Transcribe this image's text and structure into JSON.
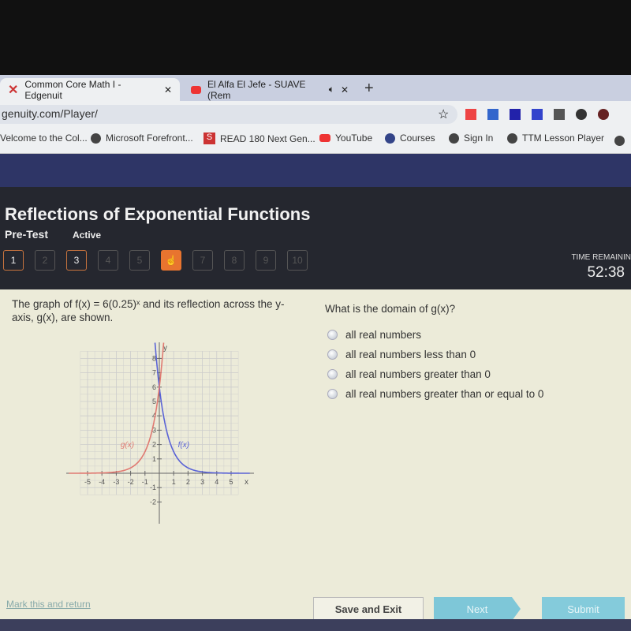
{
  "browser": {
    "tabs": [
      {
        "title": "Common Core Math I - Edgenuit",
        "icon": "edgenuity-x-icon"
      },
      {
        "title": "El Alfa El Jefe - SUAVE (Rem",
        "icon": "youtube-icon",
        "audio": true
      }
    ],
    "url": "genuity.com/Player/",
    "bookmarks": [
      {
        "label": "Velcome to the Col..."
      },
      {
        "label": "Microsoft Forefront..."
      },
      {
        "label": "READ 180 Next Gen..."
      },
      {
        "label": "YouTube"
      },
      {
        "label": "Courses"
      },
      {
        "label": "Sign In"
      },
      {
        "label": "TTM Lesson Player"
      }
    ]
  },
  "header": {
    "title": "Reflections of Exponential Functions",
    "subtitle": "Pre-Test",
    "status": "Active",
    "questions": [
      "1",
      "2",
      "3",
      "4",
      "5",
      "6",
      "7",
      "8",
      "9",
      "10"
    ],
    "completed": [
      1,
      3
    ],
    "current": 6,
    "time_label": "TIME REMAININ",
    "time": "52:38"
  },
  "question": {
    "text": "The graph of f(x) = 6(0.25)ˣ and its reflection across the y-axis, g(x), are shown.",
    "prompt": "What is the domain of g(x)?",
    "options": [
      "all real numbers",
      "all real numbers less than 0",
      "all real numbers greater than 0",
      "all real numbers greater than or equal to 0"
    ]
  },
  "graph": {
    "xlim": [
      -5,
      5
    ],
    "ylim": [
      -2,
      8
    ],
    "xlabel": "x",
    "ylabel": "y",
    "xticks": [
      -5,
      -4,
      -3,
      -2,
      -1,
      1,
      2,
      3,
      4,
      5
    ],
    "yticks": [
      -2,
      -1,
      1,
      2,
      3,
      4,
      5,
      6,
      7,
      8
    ],
    "series": [
      {
        "name": "f(x)",
        "formula": "6(0.25)^x",
        "color": "#5a63d6"
      },
      {
        "name": "g(x)",
        "formula": "6(4)^x",
        "color": "#e07a72"
      }
    ]
  },
  "footer": {
    "mark": "Mark this and return",
    "save": "Save and Exit",
    "next": "Next",
    "submit": "Submit"
  }
}
